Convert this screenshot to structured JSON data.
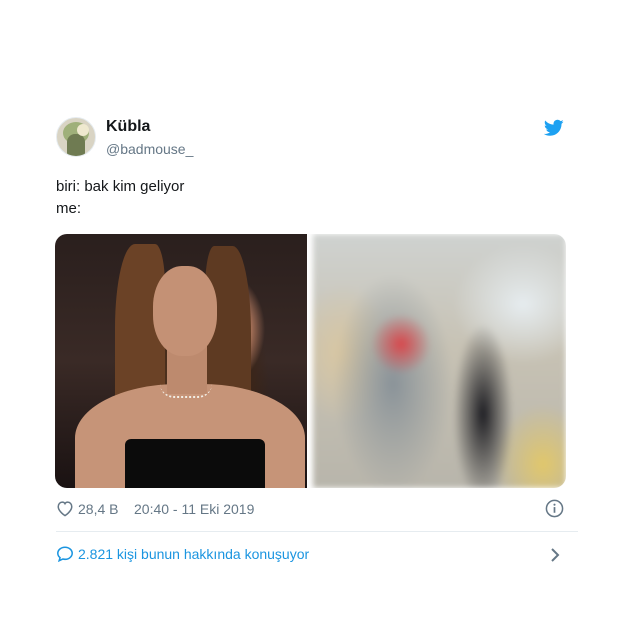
{
  "tweet": {
    "user": {
      "name": "Kübla",
      "handle": "@badmouse_"
    },
    "text": {
      "line1": "biri: bak kim geliyor",
      "line2": "me:"
    },
    "media": {
      "left": "photo-woman-long-hair",
      "right": "blurred-photo"
    },
    "stats": {
      "likes": "28,4 B",
      "timestamp": "20:40 - 11 Eki 2019"
    },
    "conversation": {
      "label": "2.821 kişi bunun hakkında konuşuyor"
    },
    "icons": {
      "brand": "twitter-bird-icon",
      "like": "heart-icon",
      "info": "info-icon",
      "conversation": "speech-bubble-icon",
      "more": "chevron-right-icon"
    },
    "colors": {
      "accent": "#1da1f2",
      "link": "#1b95e0",
      "secondary": "#657786",
      "text": "#14171a"
    }
  }
}
